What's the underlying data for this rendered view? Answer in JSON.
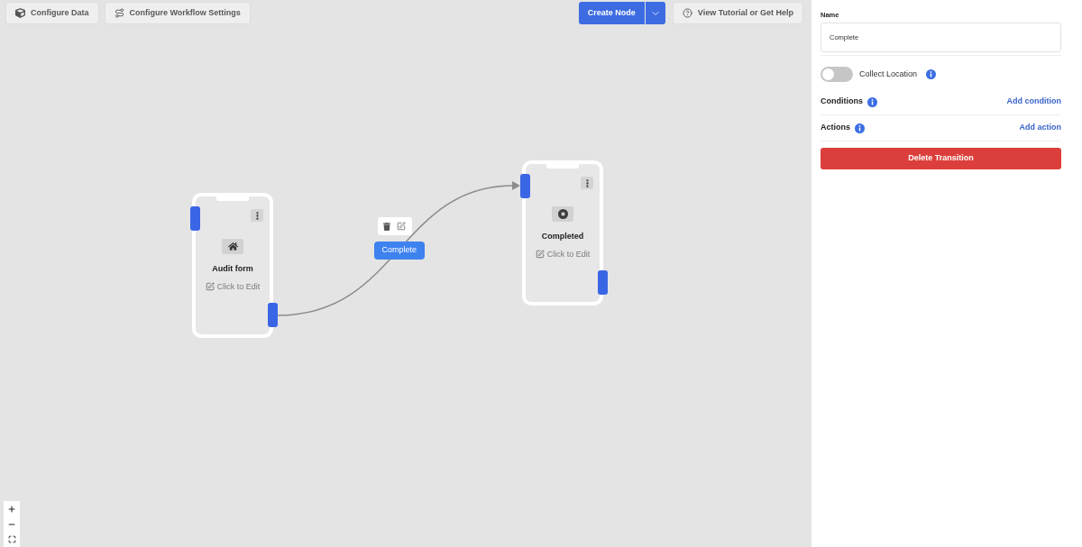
{
  "toolbar": {
    "left_buttons": [
      {
        "kind": "data",
        "label": "Configure Data"
      },
      {
        "kind": "workflow",
        "label": "Configure Workflow Settings"
      }
    ],
    "create_node": {
      "label": "Create Node"
    },
    "help_button": {
      "label": "View Tutorial or Get Help"
    }
  },
  "canvas": {
    "nodes": [
      {
        "kind": "start",
        "title": "Audit form",
        "edit_label": "Click to Edit"
      },
      {
        "kind": "end",
        "title": "Completed",
        "edit_label": "Click to Edit"
      }
    ],
    "edges": [
      {
        "label": "Complete",
        "selected": true
      }
    ]
  },
  "panel": {
    "name_field": {
      "label": "Name",
      "value": "Complete"
    },
    "collect_location": {
      "label": "Collect Location",
      "on": false
    },
    "sections": [
      {
        "title": "Conditions",
        "link": "Add condition"
      },
      {
        "title": "Actions",
        "link": "Add action"
      }
    ],
    "delete_button": {
      "label": "Delete Transition"
    }
  }
}
